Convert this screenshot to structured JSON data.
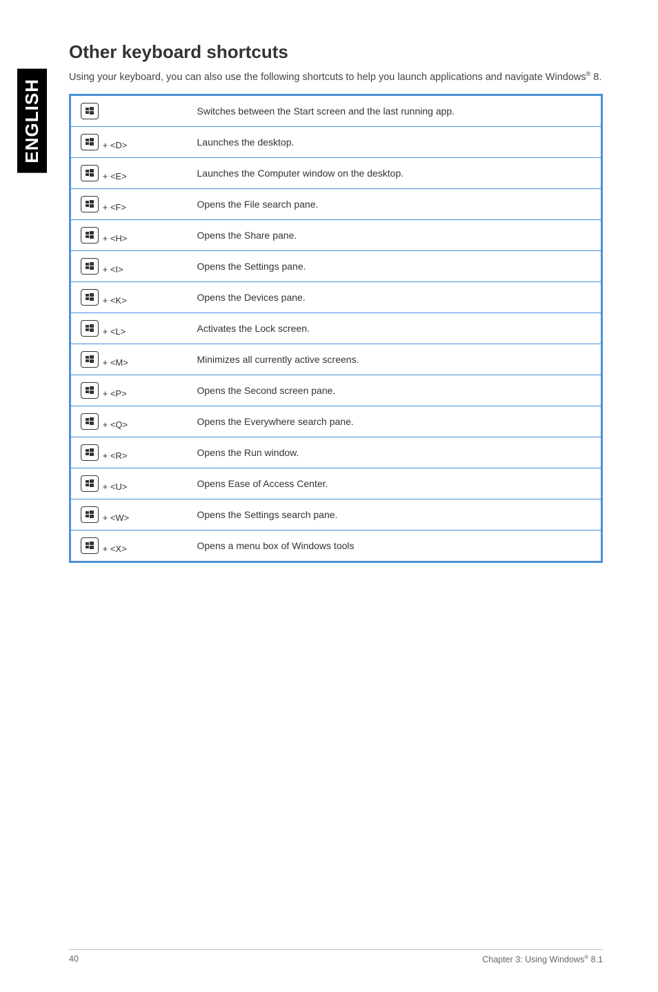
{
  "side_tab": "ENGLISH",
  "title": "Other keyboard shortcuts",
  "intro_pre": "Using your keyboard, you can also use the following shortcuts to help you launch applications and navigate Windows",
  "intro_sup": "®",
  "intro_post": " 8.",
  "rows": [
    {
      "keys": "",
      "desc": "Switches between the Start screen and the last running app."
    },
    {
      "keys": " + <D>",
      "desc": "Launches the desktop."
    },
    {
      "keys": " + <E>",
      "desc": "Launches the Computer window on the desktop."
    },
    {
      "keys": " + <F>",
      "desc": "Opens the File search pane."
    },
    {
      "keys": " + <H>",
      "desc": "Opens the Share pane."
    },
    {
      "keys": " + <I>",
      "desc": "Opens the Settings pane."
    },
    {
      "keys": " + <K>",
      "desc": "Opens the Devices pane."
    },
    {
      "keys": " + <L>",
      "desc": "Activates the Lock screen."
    },
    {
      "keys": " + <M>",
      "desc": "Minimizes all currently active screens."
    },
    {
      "keys": " + <P>",
      "desc": "Opens the Second screen pane."
    },
    {
      "keys": " + <Q>",
      "desc": "Opens the Everywhere search pane."
    },
    {
      "keys": " + <R>",
      "desc": "Opens the Run window."
    },
    {
      "keys": " + <U>",
      "desc": "Opens Ease of Access Center."
    },
    {
      "keys": " + <W>",
      "desc": "Opens the Settings search pane."
    },
    {
      "keys": " + <X>",
      "desc": "Opens a menu box of Windows tools"
    }
  ],
  "footer": {
    "page_no": "40",
    "chapter_pre": "Chapter 3:  Using Windows",
    "chapter_sup": "®",
    "chapter_post": " 8.1"
  }
}
